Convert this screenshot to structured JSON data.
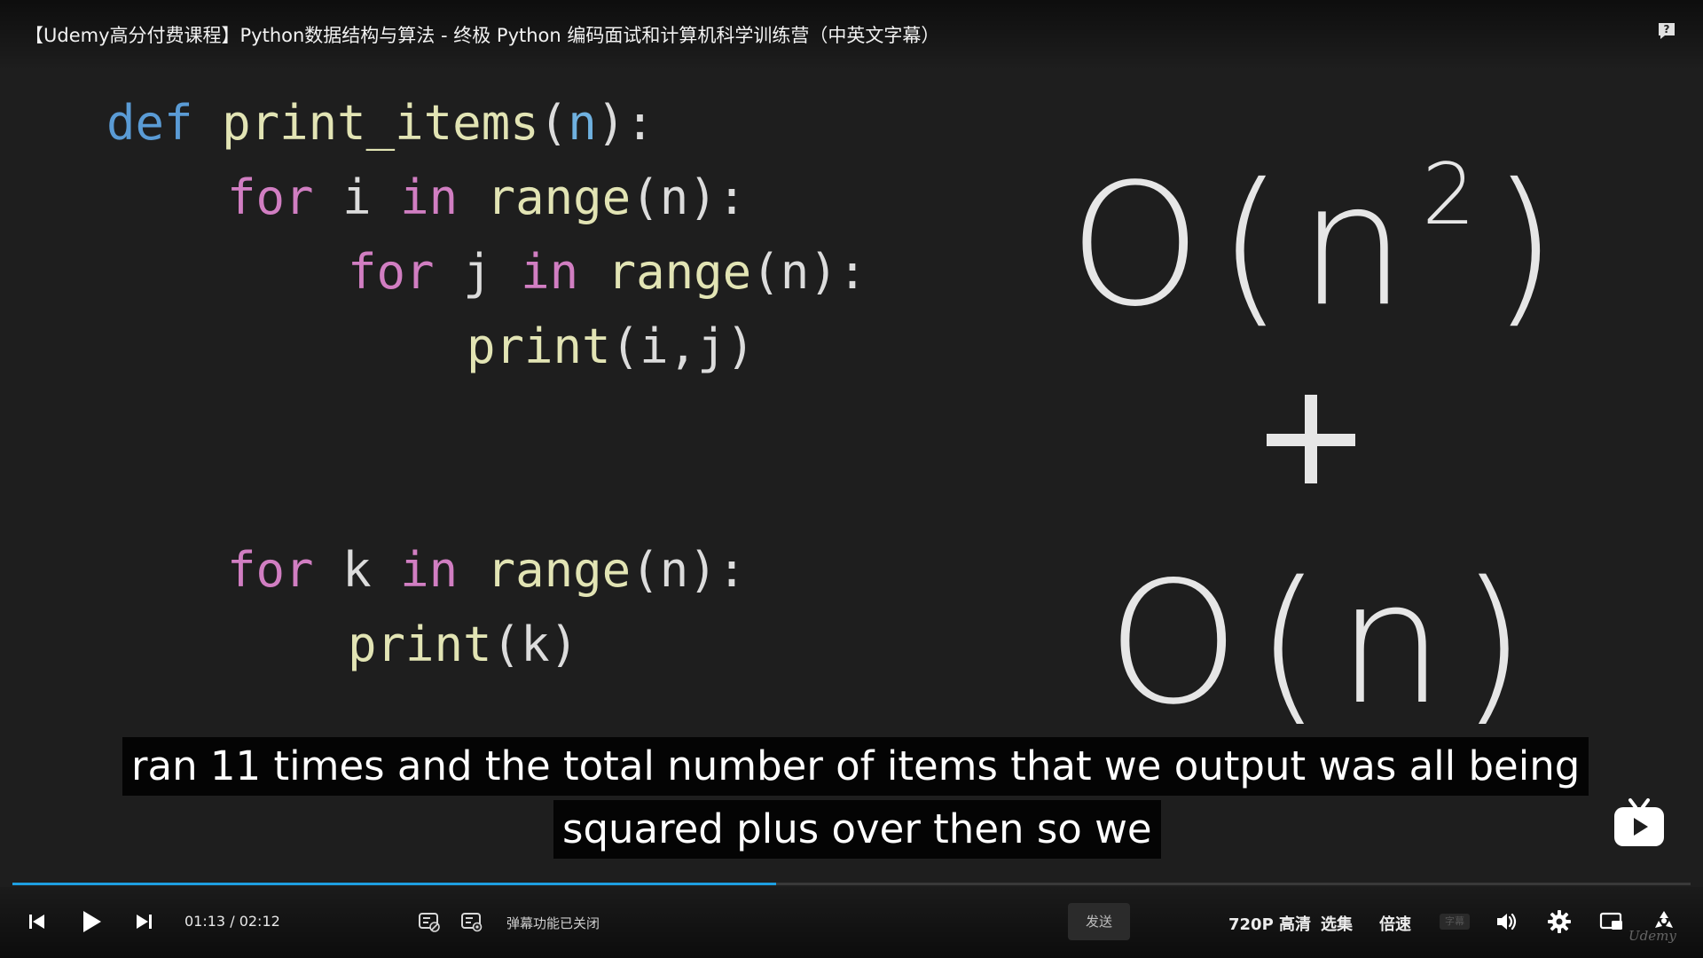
{
  "header": {
    "title": "【Udemy高分付费课程】Python数据结构与算法 - 终极 Python 编码面试和计算机科学训练营（中英文字幕）"
  },
  "code": {
    "line1": {
      "kw": "def",
      "fn": "print_items",
      "open": "(",
      "param": "n",
      "close": "):"
    },
    "line2": {
      "kw1": "for",
      "var": "i",
      "kw2": "in",
      "fn": "range",
      "rest": "(n):"
    },
    "line3": {
      "kw1": "for",
      "var": "j",
      "kw2": "in",
      "fn": "range",
      "rest": "(n):"
    },
    "line4": {
      "fn": "print",
      "rest": "(i,j)"
    },
    "line5": {
      "kw1": "for",
      "var": "k",
      "kw2": "in",
      "fn": "range",
      "rest": "(n):"
    },
    "line6": {
      "fn": "print",
      "rest": "(k)"
    }
  },
  "complexity": {
    "top_base": "O(n",
    "top_exp": "2",
    "top_close": ")",
    "plus": "+",
    "bottom": "O(n)"
  },
  "subtitles": {
    "line1": "ran 11 times and the total number of items that we output was all being",
    "line2": "squared plus over then so we"
  },
  "controls": {
    "current_time": "01:13",
    "separator": "/",
    "total_time": "02:12",
    "progress": 0.455,
    "danmaku_status": "弹幕功能已关闭",
    "send_label": "发送",
    "quality_label": "720P 高清",
    "episodes_label": "选集",
    "speed_label": "倍速",
    "subtitle_toggle_label": "字幕",
    "accent_color": "#1e9fe0"
  },
  "watermark": "Udemy"
}
